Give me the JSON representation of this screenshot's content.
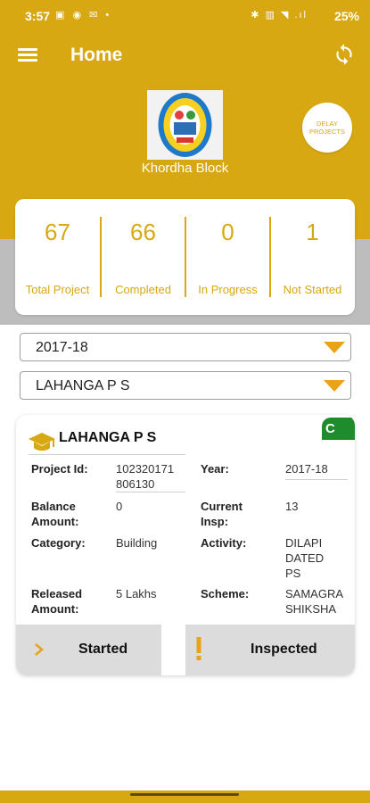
{
  "status_bar": {
    "time": "3:57",
    "left_icons": "▣ ◉ ✉ •",
    "right_icons": "✱ ▥ ◥ .ıl",
    "battery": "25%"
  },
  "app_bar": {
    "title": "Home"
  },
  "header": {
    "block_name": "Khordha Block",
    "delay_projects_label": "DELAY PROJECTS"
  },
  "stats": [
    {
      "value": "67",
      "label": "Total Project"
    },
    {
      "value": "66",
      "label": "Completed"
    },
    {
      "value": "0",
      "label": "In Progress"
    },
    {
      "value": "1",
      "label": "Not Started"
    }
  ],
  "filters": {
    "year": "2017-18",
    "school": "LAHANGA P S"
  },
  "project": {
    "badge": "C",
    "name": "LAHANGA P S",
    "fields": {
      "project_id_label": "Project Id:",
      "project_id_line1": "102320171",
      "project_id_line2": "806130",
      "year_label": "Year:",
      "year_value": "2017-18",
      "balance_label_1": "Balance",
      "balance_label_2": "Amount:",
      "balance_value": "0",
      "current_label_1": "Current",
      "current_label_2": "Insp:",
      "current_value": "13",
      "category_label": "Category:",
      "category_value": "Building",
      "activity_label": "Activity:",
      "activity_line1": "DILAPI",
      "activity_line2": "DATED",
      "activity_line3": "PS",
      "released_label_1": "Released",
      "released_label_2": "Amount:",
      "released_value": "5 Lakhs",
      "scheme_label": "Scheme:",
      "scheme_line1": "SAMAGRA",
      "scheme_line2": "SHIKSHA"
    },
    "actions": {
      "started_label": "Started",
      "inspected_label": "Inspected"
    }
  },
  "colors": {
    "primary": "#d8a812",
    "accent": "#e8a317",
    "badge_green": "#1e8c2c",
    "gray_band": "#bdbdbd"
  }
}
